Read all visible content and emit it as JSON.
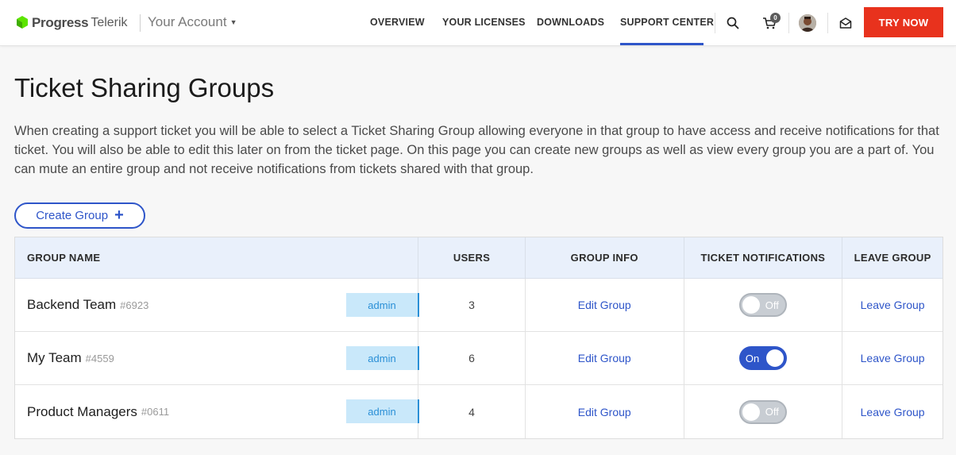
{
  "header": {
    "brand": "Progress",
    "product": "Telerik",
    "account_label": "Your Account",
    "nav": [
      "OVERVIEW",
      "YOUR LICENSES",
      "DOWNLOADS",
      "SUPPORT CENTER"
    ],
    "active_nav": "SUPPORT CENTER",
    "cart_count": "0",
    "try_now": "TRY NOW"
  },
  "page": {
    "title": "Ticket Sharing Groups",
    "intro": "When creating a support ticket you will be able to select a Ticket Sharing Group allowing everyone in that group to have access and receive notifications for that ticket. You will also be able to edit this later on from the ticket page. On this page you can create new groups as well as view every group you are a part of. You can mute an entire group and not receive notifications from tickets shared with that group.",
    "create_button": "Create Group"
  },
  "table": {
    "headers": [
      "GROUP NAME",
      "USERS",
      "GROUP INFO",
      "TICKET NOTIFICATIONS",
      "LEAVE GROUP"
    ],
    "rows": [
      {
        "name": "Backend Team",
        "id": "#6923",
        "role": "admin",
        "users": "3",
        "edit": "Edit Group",
        "notifications": "Off",
        "leave": "Leave Group"
      },
      {
        "name": "My Team",
        "id": "#4559",
        "role": "admin",
        "users": "6",
        "edit": "Edit Group",
        "notifications": "On",
        "leave": "Leave Group"
      },
      {
        "name": "Product Managers",
        "id": "#0611",
        "role": "admin",
        "users": "4",
        "edit": "Edit Group",
        "notifications": "Off",
        "leave": "Leave Group"
      }
    ]
  },
  "colors": {
    "accent": "#2e55c9",
    "cta": "#e8321d",
    "brand_green": "#5ce500",
    "admin_badge_bg": "#c9e8fa"
  }
}
